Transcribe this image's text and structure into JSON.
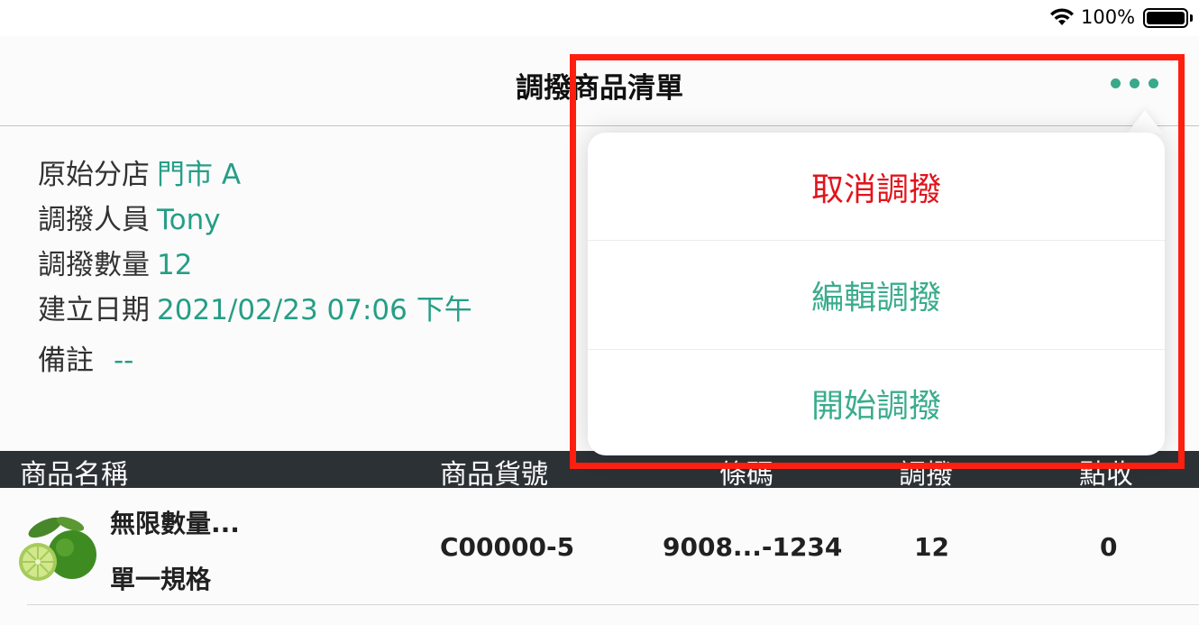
{
  "status_bar": {
    "battery_percent": "100%",
    "icons": [
      "wifi-icon",
      "battery-icon"
    ]
  },
  "nav": {
    "title": "調撥商品清單",
    "more_icon": "more-dots-icon"
  },
  "info": {
    "source_store_label": "原始分店",
    "source_store_value": "門市 A",
    "staff_label": "調撥人員",
    "staff_value": "Tony",
    "quantity_label": "調撥數量",
    "quantity_value": "12",
    "created_label": "建立日期",
    "created_value": "2021/02/23 07:06 下午",
    "note_label": "備註",
    "note_value": "--"
  },
  "table": {
    "headers": [
      "商品名稱",
      "商品貨號",
      "條碼",
      "調撥",
      "點收"
    ],
    "rows": [
      {
        "name": "無限數量...",
        "spec": "單一規格",
        "sku": "C00000-5",
        "barcode": "9008...-1234",
        "transfer": "12",
        "received": "0",
        "image": "lime-image"
      }
    ]
  },
  "popover": {
    "items": [
      {
        "label": "取消調撥",
        "style": "destructive"
      },
      {
        "label": "編輯調撥",
        "style": "normal"
      },
      {
        "label": "開始調撥",
        "style": "normal"
      }
    ]
  },
  "colors": {
    "accent": "#3aac8c",
    "value_text": "#27a189",
    "destructive": "#e1141c",
    "header_bg": "#2d3237",
    "highlight": "#ff1f0f"
  }
}
